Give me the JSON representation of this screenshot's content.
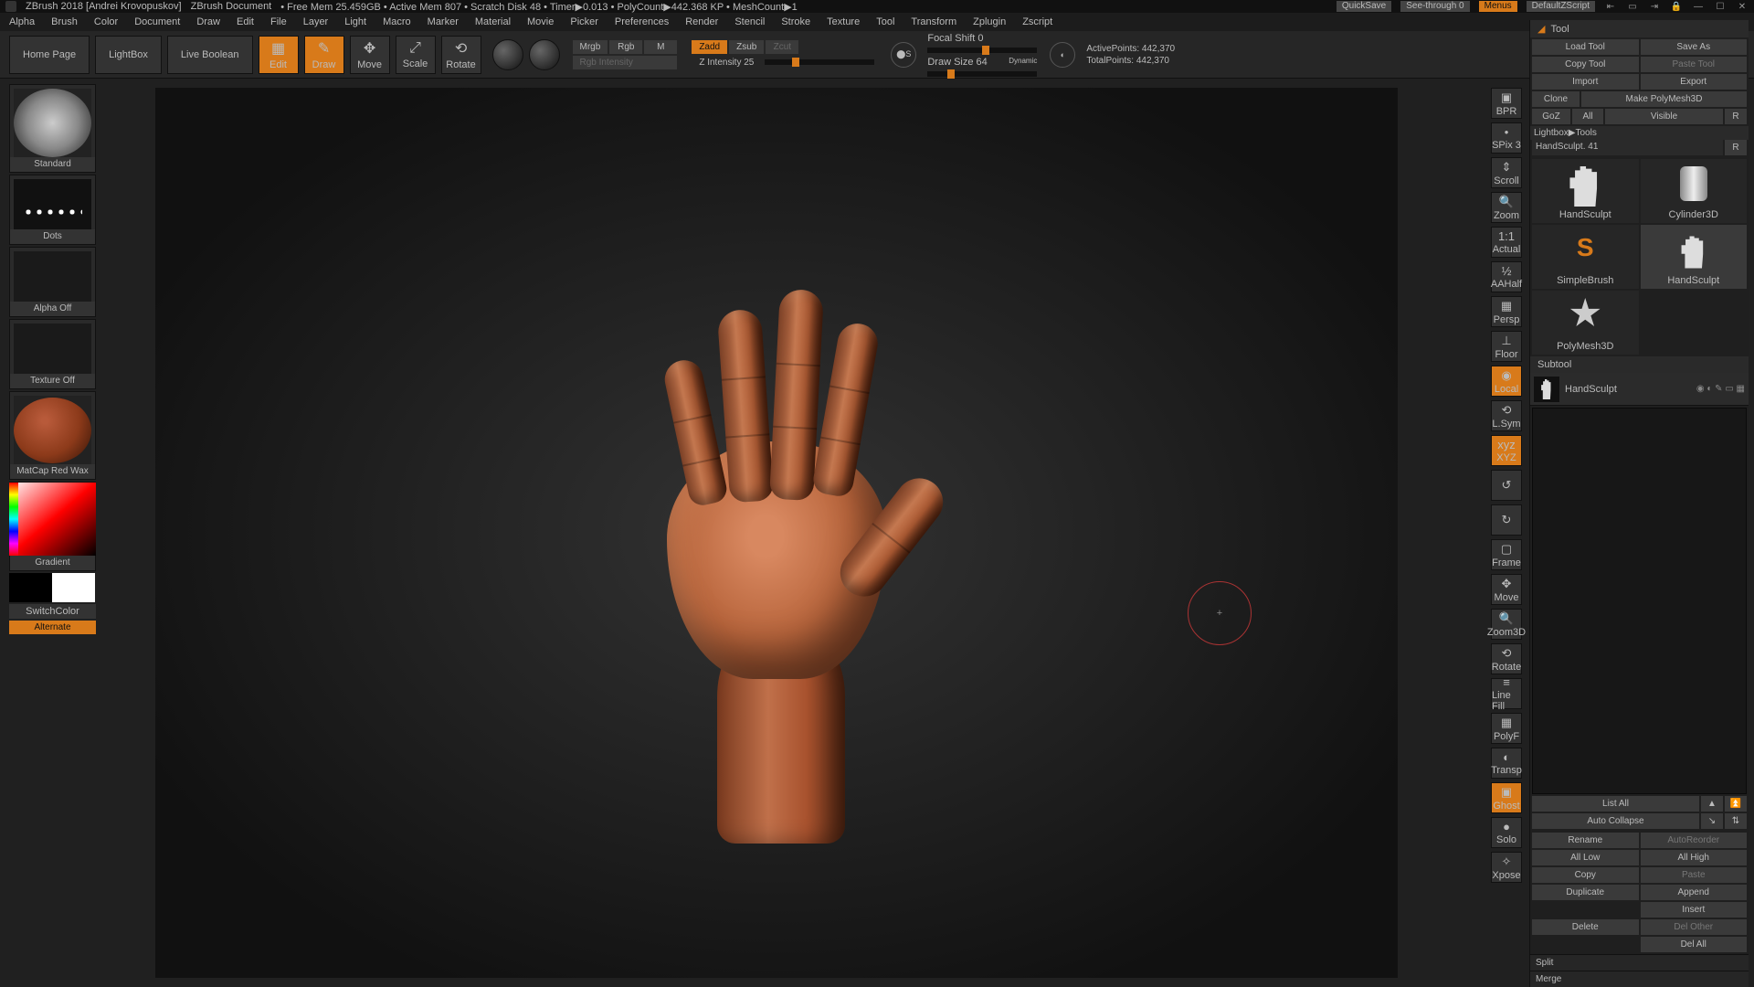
{
  "title": {
    "app": "ZBrush 2018 [Andrei Krovopuskov]",
    "doc": "ZBrush Document",
    "stats": "•  Free Mem 25.459GB  •  Active Mem 807  •  Scratch Disk 48  •  Timer▶0.013  •  PolyCount▶442.368 KP  •  MeshCount▶1",
    "quicksave": "QuickSave",
    "seethrough": "See-through  0",
    "menus": "Menus",
    "zscript": "DefaultZScript"
  },
  "menu": [
    "Alpha",
    "Brush",
    "Color",
    "Document",
    "Draw",
    "Edit",
    "File",
    "Layer",
    "Light",
    "Macro",
    "Marker",
    "Material",
    "Movie",
    "Picker",
    "Preferences",
    "Render",
    "Stencil",
    "Stroke",
    "Texture",
    "Tool",
    "Transform",
    "Zplugin",
    "Zscript"
  ],
  "toolbar": {
    "home": "Home Page",
    "lightbox": "LightBox",
    "liveboolean": "Live Boolean",
    "edit": "Edit",
    "draw": "Draw",
    "move": "Move",
    "scale": "Scale",
    "rotate": "Rotate",
    "modes": {
      "mrgb": "Mrgb",
      "rgb": "Rgb",
      "m": "M",
      "rgb_int": "Rgb Intensity"
    },
    "zmodes": {
      "zadd": "Zadd",
      "zsub": "Zsub",
      "zcut": "Zcut",
      "zint": "Z Intensity 25"
    },
    "focal": {
      "label": "Focal Shift 0"
    },
    "drawsize": {
      "label": "Draw Size 64",
      "dynamic": "Dynamic"
    },
    "active": "ActivePoints: 442,370",
    "total": "TotalPoints: 442,370"
  },
  "left": {
    "brush": "Standard",
    "stroke": "Dots",
    "alpha": "Alpha Off",
    "texture": "Texture Off",
    "material": "MatCap Red Wax",
    "gradient": "Gradient",
    "switch": "SwitchColor",
    "alternate": "Alternate"
  },
  "rail": [
    "BPR",
    "SPix 3",
    "Scroll",
    "Zoom",
    "Actual",
    "AAHalf",
    "Persp",
    "Floor",
    "Local",
    "L.Sym",
    "XYZ",
    "",
    "",
    "Frame",
    "Move",
    "Zoom3D",
    "Rotate",
    "Line Fill",
    "PolyF",
    "Transp",
    "Ghost",
    "Solo",
    "Xpose"
  ],
  "rail_on": {
    "8": true,
    "10": true,
    "20": true
  },
  "tool": {
    "title": "Tool",
    "load": "Load Tool",
    "saveas": "Save As",
    "copy": "Copy Tool",
    "paste": "Paste Tool",
    "import": "Import",
    "export": "Export",
    "clone": "Clone",
    "makepm3d": "Make PolyMesh3D",
    "goz": "GoZ",
    "all": "All",
    "visible": "Visible",
    "r": "R",
    "lbpath": "Lightbox▶Tools",
    "current": "HandSculpt. 41",
    "thumbs": [
      "HandSculpt",
      "Cylinder3D",
      "PolyMesh3D",
      "SimpleBrush",
      "HandSculpt"
    ],
    "subtool_hdr": "Subtool",
    "subtool_item": "HandSculpt",
    "listall": "List All",
    "autocollapse": "Auto Collapse",
    "rename": "Rename",
    "autoreorder": "AutoReorder",
    "alllow": "All Low",
    "allhigh": "All High",
    "copy2": "Copy",
    "paste2": "Paste",
    "duplicate": "Duplicate",
    "append": "Append",
    "insert": "Insert",
    "delete": "Delete",
    "delother": "Del Other",
    "delall": "Del All",
    "split": "Split",
    "merge": "Merge"
  }
}
